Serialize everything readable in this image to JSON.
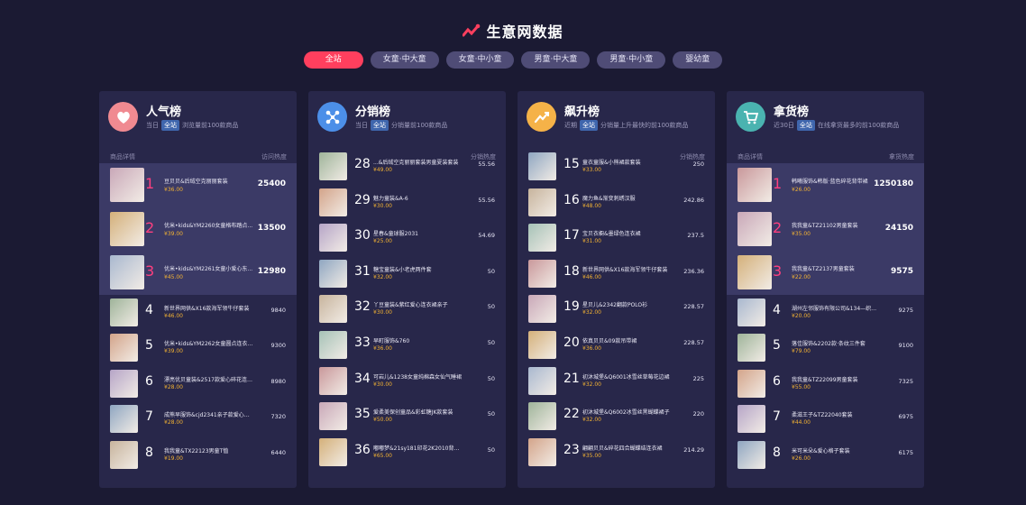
{
  "header": {
    "title": "生意网数据",
    "logo_icon": "trend-logo-icon"
  },
  "tabs": [
    {
      "label": "全站",
      "active": true
    },
    {
      "label": "女童·中大童",
      "active": false
    },
    {
      "label": "女童·中小童",
      "active": false
    },
    {
      "label": "男童·中大童",
      "active": false
    },
    {
      "label": "男童·中小童",
      "active": false
    },
    {
      "label": "婴幼童",
      "active": false
    }
  ],
  "panels": [
    {
      "title": "人气榜",
      "icon": "heart-face-icon",
      "icon_color": "#f08a91",
      "sub_prefix": "当日",
      "badge": "全站",
      "sub_text": "浏览量前100款商品",
      "col_left": "商品详情",
      "col_right": "访问热度",
      "rows": [
        {
          "rank": "1",
          "name": "豆贝贝&后绒空克丽丽套装",
          "price": "¥36.00",
          "value": "25400"
        },
        {
          "rank": "2",
          "name": "优米•kids&YM2260女童格布踏点...",
          "price": "¥39.00",
          "value": "13500"
        },
        {
          "rank": "3",
          "name": "优米•kids&YM2261女童小爱心东...",
          "price": "¥45.00",
          "value": "12980"
        },
        {
          "rank": "4",
          "name": "新世界网供&X16款海军领牛仔套装",
          "price": "¥46.00",
          "value": "9840"
        },
        {
          "rank": "5",
          "name": "优米•kids&YM2262女童圆点连衣裙·",
          "price": "¥39.00",
          "value": "9300"
        },
        {
          "rank": "6",
          "name": "漂亮优贝童装&2517款爱心碎花连衣裙",
          "price": "¥28.00",
          "value": "8980"
        },
        {
          "rank": "7",
          "name": "成熊早服饰&cjd2341亲子款爱心娃娃领POL...",
          "price": "¥28.00",
          "value": "7320"
        },
        {
          "rank": "8",
          "name": "我我童&TX22123男童T恤",
          "price": "¥19.00",
          "value": "6440"
        }
      ]
    },
    {
      "title": "分销榜",
      "icon": "share-nodes-icon",
      "icon_color": "#4c8fe8",
      "sub_prefix": "当日",
      "badge": "全站",
      "sub_text": "分销量前100款商品",
      "col_left": "商品详情",
      "col_right": "分销热度",
      "rows": [
        {
          "rank": "28",
          "name": "...&后绒空克丽丽套装男童夏装套装",
          "price": "¥49.00",
          "value": "55.56"
        },
        {
          "rank": "29",
          "name": "魅力童装&A-6",
          "price": "¥30.00",
          "value": "55.56"
        },
        {
          "rank": "30",
          "name": "星春&童球服2031",
          "price": "¥25.00",
          "value": "54.69"
        },
        {
          "rank": "31",
          "name": "糖宝童装&小老虎两件套",
          "price": "¥32.00",
          "value": "50"
        },
        {
          "rank": "32",
          "name": "丫豆童装&紫红爱心连衣裙亲子",
          "price": "¥30.00",
          "value": "50"
        },
        {
          "rank": "33",
          "name": "早町服饰&760",
          "price": "¥36.00",
          "value": "50"
        },
        {
          "rank": "34",
          "name": "可岩儿&1238女童纯棉森女仙气睡裙",
          "price": "¥30.00",
          "value": "50"
        },
        {
          "rank": "35",
          "name": "爱柔美保创童品&彩虹糖JK款套装",
          "price": "¥50.00",
          "value": "50"
        },
        {
          "rank": "36",
          "name": "嘟嘟梦&21sy181印花2K2010背带裤",
          "price": "¥65.00",
          "value": "50"
        },
        {
          "rank": "37",
          "name": "贝儿宝贝&冰丝格子睡衣套装",
          "price": "¥29.00",
          "value": "50"
        }
      ]
    },
    {
      "title": "飙升榜",
      "icon": "trend-up-icon",
      "icon_color": "#f5b248",
      "sub_prefix": "近期",
      "badge": "全站",
      "sub_text": "分销量上升最快的前100款商品",
      "col_left": "商品详情",
      "col_right": "分销热度",
      "rows": [
        {
          "rank": "15",
          "name": "童衣童服&小熊裙款套装",
          "price": "¥33.00",
          "value": "250"
        },
        {
          "rank": "16",
          "name": "魔力鱼&渐变刺绣汉服",
          "price": "¥48.00",
          "value": "242.86"
        },
        {
          "rank": "17",
          "name": "宝贝衣橱&墨绿色连衣裙",
          "price": "¥31.00",
          "value": "237.5"
        },
        {
          "rank": "18",
          "name": "新世界网供&X16款海军领牛仔套装",
          "price": "¥46.00",
          "value": "236.36"
        },
        {
          "rank": "19",
          "name": "星贝儿&2342翻款POLO衫",
          "price": "¥32.00",
          "value": "228.57"
        },
        {
          "rank": "20",
          "name": "依真贝贝&09款吊带裙",
          "price": "¥36.00",
          "value": "228.57"
        },
        {
          "rank": "21",
          "name": "初沐城堡&Q6001冰雪丝草莓花边裙",
          "price": "¥32.00",
          "value": "225"
        },
        {
          "rank": "22",
          "name": "初沐城堡&Q6002冰雪丝黑蝴蝶裙子",
          "price": "¥32.00",
          "value": "220"
        },
        {
          "rank": "23",
          "name": "翩翩贝贝&碎花四合蝴蝶结连衣裙",
          "price": "¥35.00",
          "value": "214.29"
        }
      ]
    },
    {
      "title": "拿货榜",
      "icon": "cart-icon",
      "icon_color": "#4ab3b0",
      "sub_prefix": "近30日",
      "badge": "全站",
      "sub_text": "在线拿货最多的前100款商品",
      "col_left": "商品详情",
      "col_right": "拿货热度",
      "rows": [
        {
          "rank": "1",
          "name": "韩曦服饰&韩版·蓝色碎花背带裙",
          "price": "¥26.00",
          "value": "1250180"
        },
        {
          "rank": "2",
          "name": "我我童&TZ21102男童套装",
          "price": "¥35.00",
          "value": "24150"
        },
        {
          "rank": "3",
          "name": "我我童&TZ2137男童套装",
          "price": "¥22.00",
          "value": "9575"
        },
        {
          "rank": "4",
          "name": "湖州左邻服饰有限公司&134—织带防蚊裤",
          "price": "¥20.00",
          "value": "9275"
        },
        {
          "rank": "5",
          "name": "落佳服饰&2202款·条纹三件套",
          "price": "¥79.00",
          "value": "9100"
        },
        {
          "rank": "6",
          "name": "我我童&TZ22099男童套装",
          "price": "¥55.00",
          "value": "7325"
        },
        {
          "rank": "7",
          "name": "柔滋王子&TZ22040套装",
          "price": "¥44.00",
          "value": "6975"
        },
        {
          "rank": "8",
          "name": "米可米朵&爱心格子套装",
          "price": "¥26.00",
          "value": "6175"
        }
      ]
    }
  ]
}
